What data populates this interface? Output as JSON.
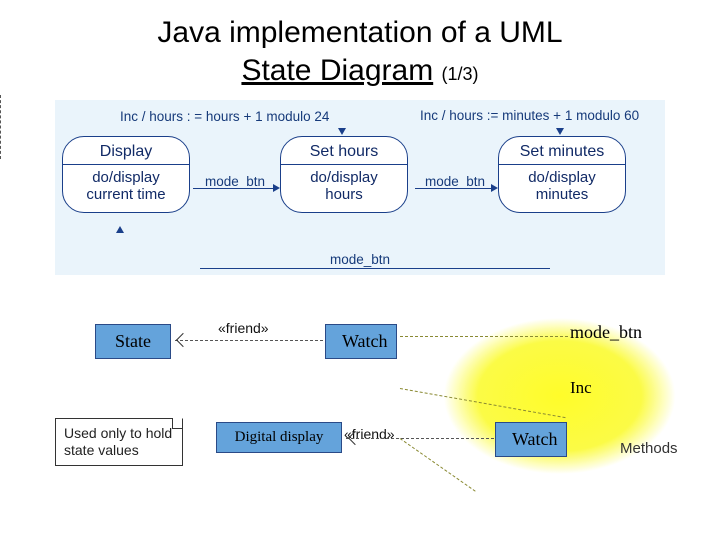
{
  "title": {
    "line": "Java implementation of a UML",
    "line2_a": "State Diagram",
    "page_indicator": "(1/3)"
  },
  "upper_states": {
    "display": {
      "name": "Display",
      "activity_a": "do/display",
      "activity_b": "current time"
    },
    "set_hours": {
      "name": "Set hours",
      "activity_a": "do/display",
      "activity_b": "hours"
    },
    "set_min": {
      "name": "Set minutes",
      "activity_a": "do/display",
      "activity_b": "minutes"
    }
  },
  "transitions": {
    "inc_hours": "Inc / hours : = hours + 1 modulo 24",
    "inc_minutes": "Inc / hours := minutes + 1 modulo 60",
    "mode_btn": "mode_btn"
  },
  "classes": {
    "state": "State",
    "watch": "Watch",
    "digital": "Digital display"
  },
  "stereotype": {
    "friend": "«friend»"
  },
  "note": {
    "text": "Used only to hold state values"
  },
  "methods": {
    "mode_btn": "mode_btn",
    "inc": "Inc",
    "label": "Methods"
  }
}
